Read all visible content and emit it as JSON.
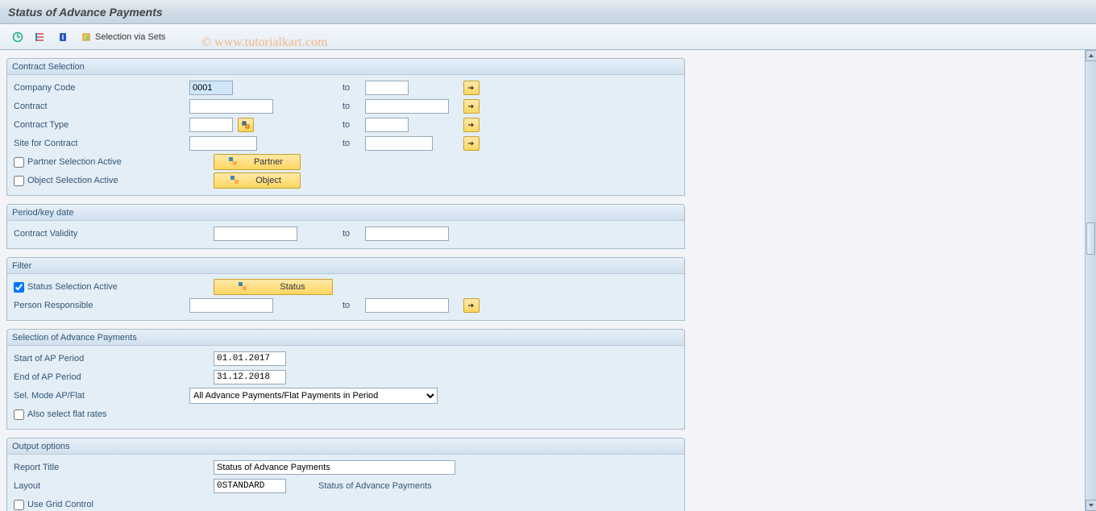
{
  "window": {
    "title": "Status of Advance Payments"
  },
  "watermark": "© www.tutorialkart.com",
  "toolbar": {
    "selection_via_sets": "Selection via Sets"
  },
  "groups": {
    "contract": {
      "title": "Contract Selection",
      "company_code": {
        "label": "Company Code",
        "from": "0001",
        "to": ""
      },
      "contract": {
        "label": "Contract",
        "from": "",
        "to": ""
      },
      "contract_type": {
        "label": "Contract Type",
        "from": "",
        "to": ""
      },
      "site": {
        "label": "Site for Contract",
        "from": "",
        "to": ""
      },
      "partner_active": {
        "label": "Partner Selection Active",
        "checked": false,
        "button": "Partner"
      },
      "object_active": {
        "label": "Object Selection Active",
        "checked": false,
        "button": "Object"
      },
      "to_label": "to"
    },
    "period": {
      "title": "Period/key date",
      "validity": {
        "label": "Contract Validity",
        "from": "",
        "to": ""
      },
      "to_label": "to"
    },
    "filter": {
      "title": "Filter",
      "status_active": {
        "label": "Status Selection Active",
        "checked": true,
        "button": "Status"
      },
      "person": {
        "label": "Person Responsible",
        "from": "",
        "to": ""
      },
      "to_label": "to"
    },
    "advance": {
      "title": "Selection of Advance Payments",
      "start": {
        "label": "Start of AP Period",
        "value": "01.01.2017"
      },
      "end": {
        "label": "End of AP Period",
        "value": "31.12.2018"
      },
      "mode": {
        "label": "Sel. Mode AP/Flat",
        "value": "All Advance Payments/Flat Payments in Period"
      },
      "flat": {
        "label": "Also select flat rates",
        "checked": false
      }
    },
    "output": {
      "title": "Output options",
      "report_title": {
        "label": "Report Title",
        "value": "Status of Advance Payments"
      },
      "layout": {
        "label": "Layout",
        "value": "0STANDARD",
        "desc": "Status of Advance Payments"
      },
      "grid": {
        "label": "Use Grid Control",
        "checked": false
      }
    }
  }
}
